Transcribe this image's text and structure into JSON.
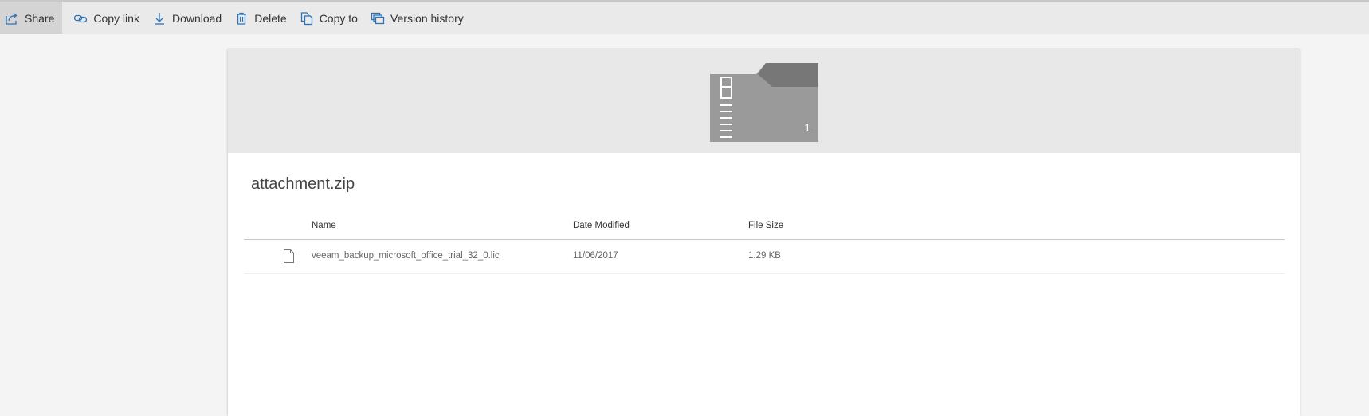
{
  "toolbar": {
    "share": "Share",
    "copy_link": "Copy link",
    "download": "Download",
    "delete": "Delete",
    "copy_to": "Copy to",
    "version_history": "Version history"
  },
  "preview": {
    "icon": "zip-folder-icon",
    "item_count": "1"
  },
  "file": {
    "title": "attachment.zip"
  },
  "table": {
    "headers": {
      "name": "Name",
      "date_modified": "Date Modified",
      "file_size": "File Size"
    },
    "rows": [
      {
        "icon": "document-icon",
        "name": "veeam_backup_microsoft_office_trial_32_0.lic",
        "date_modified": "11/06/2017",
        "file_size": "1.29 KB"
      }
    ]
  },
  "colors": {
    "accent": "#2b72b9",
    "toolbar_bg": "#eaeaea",
    "page_bg": "#f4f4f4"
  }
}
